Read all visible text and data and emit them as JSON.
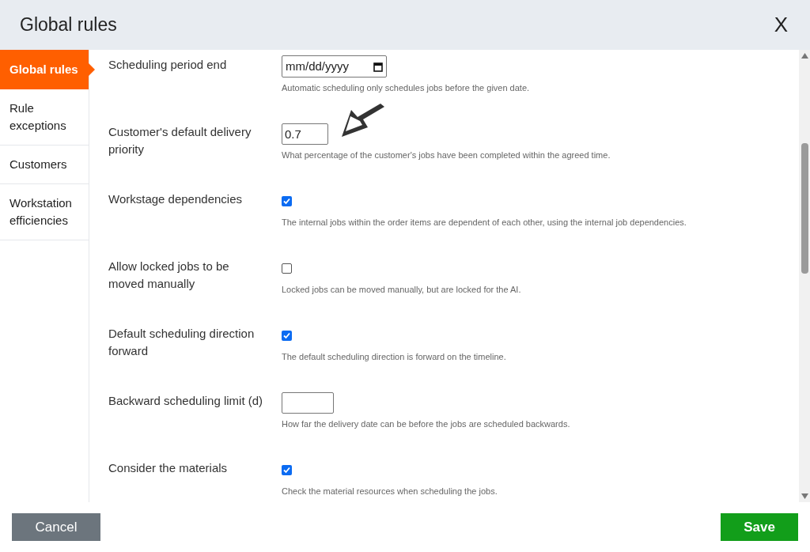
{
  "window": {
    "title": "Global rules",
    "close_label": "X"
  },
  "sidebar": {
    "items": [
      {
        "label": "Global rules",
        "selected": true
      },
      {
        "label": "Rule exceptions",
        "selected": false
      },
      {
        "label": "Customers",
        "selected": false
      },
      {
        "label": "Workstation efficiencies",
        "selected": false
      }
    ]
  },
  "settings": [
    {
      "kind": "date",
      "label": "Scheduling period end",
      "placeholder": "mm/dd/yyyy",
      "description": "Automatic scheduling only schedules jobs before the given date."
    },
    {
      "kind": "number",
      "label": "Customer's default delivery priority",
      "value": "0.7",
      "annotated": true,
      "description": "What percentage of the customer's jobs have been completed within the agreed time."
    },
    {
      "kind": "checkbox",
      "label": "Workstage dependencies",
      "checked": true,
      "description": "The internal jobs within the order items are dependent of each other, using the internal job dependencies."
    },
    {
      "kind": "checkbox",
      "label": "Allow locked jobs to be moved manually",
      "checked": false,
      "description": "Locked jobs can be moved manually, but are locked for the AI."
    },
    {
      "kind": "checkbox",
      "label": "Default scheduling direction forward",
      "checked": true,
      "description": "The default scheduling direction is forward on the timeline."
    },
    {
      "kind": "number",
      "label": "Backward scheduling limit (d)",
      "annotated": false,
      "description": "How far the delivery date can be before the jobs are scheduled backwards."
    },
    {
      "kind": "checkbox",
      "label": "Consider the materials",
      "checked": true,
      "description": "Check the material resources when scheduling the jobs."
    }
  ],
  "buttons": {
    "cancel": "Cancel",
    "save": "Save"
  }
}
